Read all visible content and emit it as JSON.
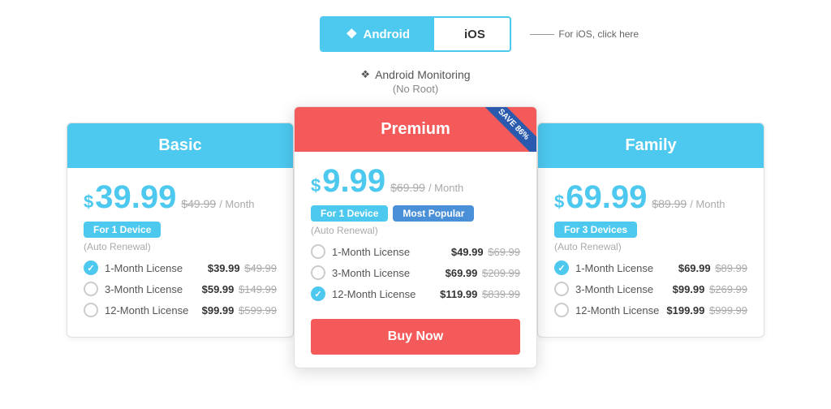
{
  "tabs": {
    "android": {
      "label": "Android",
      "active": true
    },
    "ios": {
      "label": "iOS",
      "active": false
    },
    "ios_hint": "For iOS, click here"
  },
  "platform": {
    "title": "Android Monitoring",
    "subtitle": "(No Root)"
  },
  "cards": {
    "basic": {
      "title": "Basic",
      "price_dollar": "$",
      "price_amount": "39.99",
      "price_old": "$49.99",
      "price_period": "/ Month",
      "device_badge": "For 1 Device",
      "auto_renewal": "(Auto Renewal)",
      "licenses": [
        {
          "label": "1-Month License",
          "current": "$39.99",
          "old": "$49.99",
          "checked": true
        },
        {
          "label": "3-Month License",
          "current": "$59.99",
          "old": "$149.99",
          "checked": false
        },
        {
          "label": "12-Month License",
          "current": "$99.99",
          "old": "$599.99",
          "checked": false
        }
      ]
    },
    "premium": {
      "title": "Premium",
      "save_badge": "SAVE 86%",
      "price_dollar": "$",
      "price_amount": "9.99",
      "price_old": "$69.99",
      "price_period": "/ Month",
      "device_badge": "For 1 Device",
      "popular_badge": "Most Popular",
      "auto_renewal": "(Auto Renewal)",
      "buy_label": "Buy Now",
      "licenses": [
        {
          "label": "1-Month License",
          "current": "$49.99",
          "old": "$69.99",
          "checked": false
        },
        {
          "label": "3-Month License",
          "current": "$69.99",
          "old": "$209.99",
          "checked": false
        },
        {
          "label": "12-Month License",
          "current": "$119.99",
          "old": "$839.99",
          "checked": true
        }
      ]
    },
    "family": {
      "title": "Family",
      "price_dollar": "$",
      "price_amount": "69.99",
      "price_old": "$89.99",
      "price_period": "/ Month",
      "device_badge": "For 3 Devices",
      "auto_renewal": "(Auto Renewal)",
      "licenses": [
        {
          "label": "1-Month License",
          "current": "$69.99",
          "old": "$89.99",
          "checked": true
        },
        {
          "label": "3-Month License",
          "current": "$99.99",
          "old": "$269.99",
          "checked": false
        },
        {
          "label": "12-Month License",
          "current": "$199.99",
          "old": "$999.99",
          "checked": false
        }
      ]
    }
  },
  "colors": {
    "cyan": "#4dc8ee",
    "salmon": "#f55a5a",
    "blue": "#4a90d9",
    "save_badge": "#2a5aad"
  }
}
